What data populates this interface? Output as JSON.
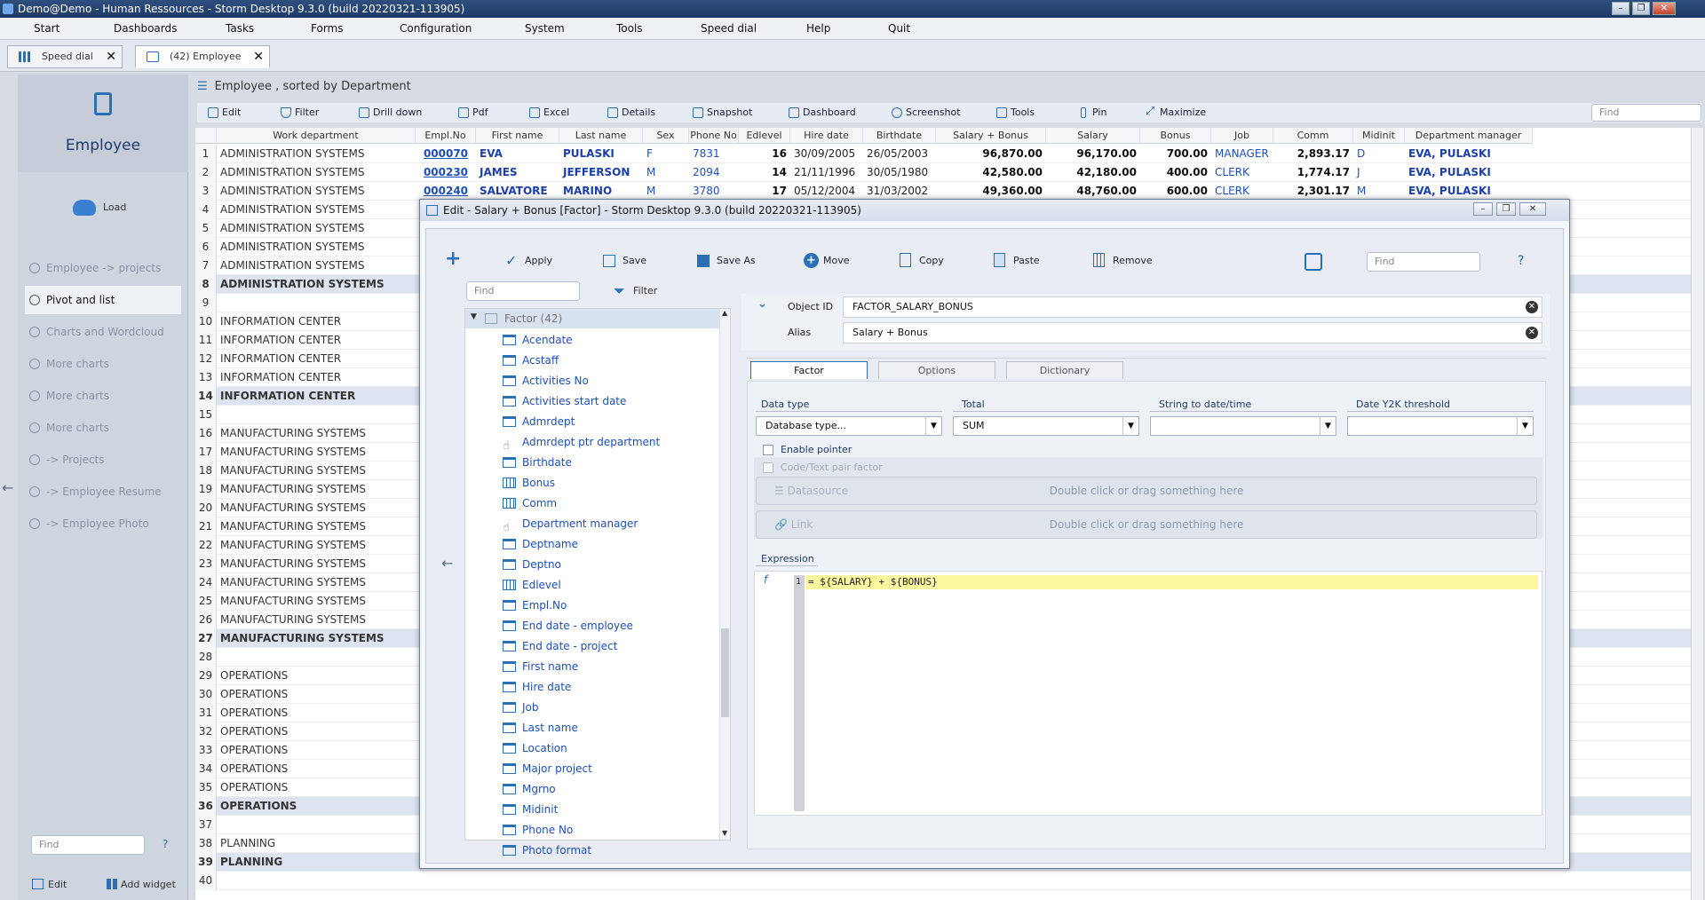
{
  "window": {
    "title": "Demo@Demo - Human Ressources - Storm Desktop 9.3.0 (build 20220321-113905)"
  },
  "menu": [
    "Start",
    "Dashboards",
    "Tasks",
    "Forms",
    "Configuration",
    "System",
    "Tools",
    "Speed dial",
    "Help",
    "Quit"
  ],
  "tabs": [
    {
      "label": "Speed dial"
    },
    {
      "label": "(42) Employee"
    }
  ],
  "left": {
    "title": "Employee",
    "load": "Load",
    "nav": [
      "Employee -> projects",
      "Pivot and list",
      "Charts and Wordcloud",
      "More charts",
      "More charts",
      "More charts",
      "-> Projects",
      "-> Employee Resume",
      "-> Employee Photo"
    ],
    "find_placeholder": "Find",
    "help": "?",
    "edit": "Edit",
    "add_widget": "Add widget"
  },
  "main": {
    "title": "Employee , sorted by Department",
    "toolbar": [
      "Edit",
      "Filter",
      "Drill down",
      "Pdf",
      "Excel",
      "Details",
      "Snapshot",
      "Dashboard",
      "Screenshot",
      "Tools",
      "Pin",
      "Maximize"
    ],
    "find_placeholder": "Find",
    "columns": [
      "Work department",
      "Empl.No",
      "First name",
      "Last name",
      "Sex",
      "Phone No",
      "Edlevel",
      "Hire date",
      "Birthdate",
      "Salary + Bonus",
      "Salary",
      "Bonus",
      "Job",
      "Comm",
      "Midinit",
      "Department manager"
    ],
    "rows": [
      {
        "n": "1",
        "dept": "ADMINISTRATION SYSTEMS",
        "emp": "000070",
        "first": "EVA",
        "last": "PULASKI",
        "sex": "F",
        "phone": "7831",
        "ed": "16",
        "hire": "30/09/2005",
        "birth": "26/05/2003",
        "sb": "96,870.00",
        "sal": "96,170.00",
        "bonus": "700.00",
        "job": "MANAGER",
        "comm": "2,893.17",
        "mid": "D",
        "mgr": "EVA, PULASKI"
      },
      {
        "n": "2",
        "dept": "ADMINISTRATION SYSTEMS",
        "emp": "000230",
        "first": "JAMES",
        "last": "JEFFERSON",
        "sex": "M",
        "phone": "2094",
        "ed": "14",
        "hire": "21/11/1996",
        "birth": "30/05/1980",
        "sb": "42,580.00",
        "sal": "42,180.00",
        "bonus": "400.00",
        "job": "CLERK",
        "comm": "1,774.17",
        "mid": "J",
        "mgr": "EVA, PULASKI"
      },
      {
        "n": "3",
        "dept": "ADMINISTRATION SYSTEMS",
        "emp": "000240",
        "first": "SALVATORE",
        "last": "MARINO",
        "sex": "M",
        "phone": "3780",
        "ed": "17",
        "hire": "05/12/2004",
        "birth": "31/03/2002",
        "sb": "49,360.00",
        "sal": "48,760.00",
        "bonus": "600.00",
        "job": "CLERK",
        "comm": "2,301.17",
        "mid": "M",
        "mgr": "EVA, PULASKI"
      },
      {
        "n": "4",
        "dept": "ADMINISTRATION SYSTEMS"
      },
      {
        "n": "5",
        "dept": "ADMINISTRATION SYSTEMS"
      },
      {
        "n": "6",
        "dept": "ADMINISTRATION SYSTEMS"
      },
      {
        "n": "7",
        "dept": "ADMINISTRATION SYSTEMS"
      },
      {
        "n": "8",
        "dept": "ADMINISTRATION SYSTEMS",
        "grp": true
      },
      {
        "n": "9",
        "dept": ""
      },
      {
        "n": "10",
        "dept": "INFORMATION CENTER"
      },
      {
        "n": "11",
        "dept": "INFORMATION CENTER"
      },
      {
        "n": "12",
        "dept": "INFORMATION CENTER"
      },
      {
        "n": "13",
        "dept": "INFORMATION CENTER"
      },
      {
        "n": "14",
        "dept": "INFORMATION CENTER",
        "grp": true
      },
      {
        "n": "15",
        "dept": ""
      },
      {
        "n": "16",
        "dept": "MANUFACTURING SYSTEMS"
      },
      {
        "n": "17",
        "dept": "MANUFACTURING SYSTEMS"
      },
      {
        "n": "18",
        "dept": "MANUFACTURING SYSTEMS"
      },
      {
        "n": "19",
        "dept": "MANUFACTURING SYSTEMS"
      },
      {
        "n": "20",
        "dept": "MANUFACTURING SYSTEMS"
      },
      {
        "n": "21",
        "dept": "MANUFACTURING SYSTEMS"
      },
      {
        "n": "22",
        "dept": "MANUFACTURING SYSTEMS"
      },
      {
        "n": "23",
        "dept": "MANUFACTURING SYSTEMS"
      },
      {
        "n": "24",
        "dept": "MANUFACTURING SYSTEMS"
      },
      {
        "n": "25",
        "dept": "MANUFACTURING SYSTEMS"
      },
      {
        "n": "26",
        "dept": "MANUFACTURING SYSTEMS"
      },
      {
        "n": "27",
        "dept": "MANUFACTURING SYSTEMS",
        "grp": true
      },
      {
        "n": "28",
        "dept": ""
      },
      {
        "n": "29",
        "dept": "OPERATIONS"
      },
      {
        "n": "30",
        "dept": "OPERATIONS"
      },
      {
        "n": "31",
        "dept": "OPERATIONS"
      },
      {
        "n": "32",
        "dept": "OPERATIONS"
      },
      {
        "n": "33",
        "dept": "OPERATIONS"
      },
      {
        "n": "34",
        "dept": "OPERATIONS"
      },
      {
        "n": "35",
        "dept": "OPERATIONS"
      },
      {
        "n": "36",
        "dept": "OPERATIONS",
        "grp": true
      },
      {
        "n": "37",
        "dept": ""
      },
      {
        "n": "38",
        "dept": "PLANNING"
      },
      {
        "n": "39",
        "dept": "PLANNING",
        "grp": true
      },
      {
        "n": "40",
        "dept": ""
      }
    ]
  },
  "dialog": {
    "title": "Edit - Salary + Bonus [Factor] -  Storm Desktop 9.3.0 (build 20220321-113905)",
    "toolbar": [
      "Apply",
      "Save",
      "Save As",
      "Move",
      "Copy",
      "Paste",
      "Remove"
    ],
    "find_placeholder": "Find",
    "help": "?",
    "tree_find_placeholder": "Find",
    "tree_filter": "Filter",
    "tree_root": "Factor (42)",
    "tree_items": [
      {
        "label": "Acendate",
        "icon": "table"
      },
      {
        "label": "Acstaff",
        "icon": "table"
      },
      {
        "label": "Activities No",
        "icon": "table"
      },
      {
        "label": "Activities start date",
        "icon": "table"
      },
      {
        "label": "Admrdept",
        "icon": "table"
      },
      {
        "label": "Admrdept ptr department",
        "icon": "pointer"
      },
      {
        "label": "Birthdate",
        "icon": "table"
      },
      {
        "label": "Bonus",
        "icon": "calc"
      },
      {
        "label": "Comm",
        "icon": "calc"
      },
      {
        "label": "Department manager",
        "icon": "pointer"
      },
      {
        "label": "Deptname",
        "icon": "table"
      },
      {
        "label": "Deptno",
        "icon": "table"
      },
      {
        "label": "Edlevel",
        "icon": "calc"
      },
      {
        "label": "Empl.No",
        "icon": "table"
      },
      {
        "label": "End date - employee",
        "icon": "table"
      },
      {
        "label": "End date - project",
        "icon": "table"
      },
      {
        "label": "First name",
        "icon": "table"
      },
      {
        "label": "Hire date",
        "icon": "table"
      },
      {
        "label": "Job",
        "icon": "table"
      },
      {
        "label": "Last name",
        "icon": "table"
      },
      {
        "label": "Location",
        "icon": "table"
      },
      {
        "label": "Major project",
        "icon": "table"
      },
      {
        "label": "Mgrno",
        "icon": "table"
      },
      {
        "label": "Midinit",
        "icon": "table"
      },
      {
        "label": "Phone No",
        "icon": "table"
      },
      {
        "label": "Photo format",
        "icon": "table"
      }
    ],
    "object_id_label": "Object ID",
    "object_id": "FACTOR_SALARY_BONUS",
    "alias_label": "Alias",
    "alias": "Salary + Bonus",
    "tabs": [
      "Factor",
      "Options",
      "Dictionary"
    ],
    "data_type_label": "Data type",
    "data_type": "Database type...",
    "total_label": "Total",
    "total": "SUM",
    "str2date_label": "String to date/time",
    "y2k_label": "Date Y2K threshold",
    "enable_pointer": "Enable pointer",
    "code_text_pair": "Code/Text pair factor",
    "datasource_label": "Datasource",
    "link_label": "Link",
    "drop_hint": "Double click or drag something here",
    "expression_label": "Expression",
    "expr_line_no": "1",
    "expression": "= ${SALARY} + ${BONUS}"
  },
  "colors": {
    "accent": "#2d6fb5",
    "link": "#1d4fb8",
    "highlight": "#fbf6a0"
  }
}
